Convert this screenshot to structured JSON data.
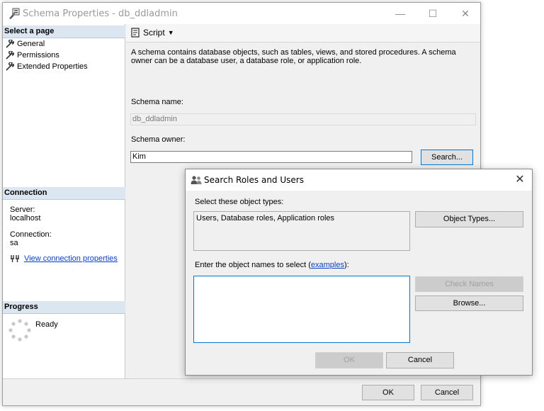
{
  "main": {
    "title": "Schema Properties - db_ddladmin",
    "controls": {
      "minimize": "—",
      "maximize": "☐",
      "close": "✕"
    },
    "select_page": {
      "header": "Select a page",
      "items": [
        {
          "label": "General",
          "icon": "wrench-icon"
        },
        {
          "label": "Permissions",
          "icon": "wrench-icon"
        },
        {
          "label": "Extended Properties",
          "icon": "wrench-icon"
        }
      ]
    },
    "connection": {
      "header": "Connection",
      "server_label": "Server:",
      "server_value": "localhost",
      "connection_label": "Connection:",
      "connection_value": "sa",
      "view_link": "View connection properties"
    },
    "progress": {
      "header": "Progress",
      "status": "Ready"
    },
    "toolbar": {
      "script_label": "Script"
    },
    "description": "A schema contains database objects, such as tables, views, and stored procedures. A schema owner can be a database user, a database role, or application role.",
    "schema_name_label": "Schema name:",
    "schema_name_value": "db_ddladmin",
    "schema_owner_label": "Schema owner:",
    "schema_owner_value": "Kim",
    "search_button": "Search...",
    "ok_button": "OK",
    "cancel_button": "Cancel"
  },
  "dialog": {
    "title": "Search Roles and Users",
    "close": "✕",
    "object_types_label": "Select these object types:",
    "object_types_value": "Users, Database roles, Application roles",
    "object_types_button": "Object Types...",
    "enter_names_prefix": "Enter the object names to select (",
    "examples_link": "examples",
    "enter_names_suffix": "):",
    "names_value": "",
    "check_names_button": "Check Names",
    "browse_button": "Browse...",
    "ok_button": "OK",
    "cancel_button": "Cancel"
  },
  "colors": {
    "accent": "#0078d7",
    "link": "#0b3fc2",
    "section_header": "#dce6f0"
  }
}
